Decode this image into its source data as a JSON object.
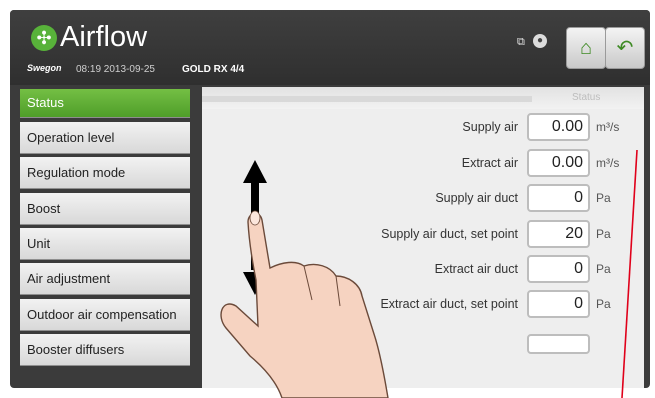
{
  "header": {
    "app_title": "Airflow",
    "brand": "Swegon",
    "timestamp": "08:19 2013-09-25",
    "unit_id": "GOLD RX",
    "page": "4/4",
    "network_icon": "network-icon",
    "user_icon": "user-icon",
    "home_icon": "home-icon",
    "back_icon": "back-arrow-icon",
    "logo_icon": "fan-icon"
  },
  "nav": {
    "items": [
      {
        "label": "Status",
        "active": true
      },
      {
        "label": "Operation level",
        "active": false
      },
      {
        "label": "Regulation mode",
        "active": false
      },
      {
        "label": "Boost",
        "active": false
      },
      {
        "label": "Unit",
        "active": false
      },
      {
        "label": "Air adjustment",
        "active": false
      },
      {
        "label": "Outdoor air compensation",
        "active": false
      },
      {
        "label": "Booster diffusers",
        "active": false
      }
    ]
  },
  "content": {
    "caption": "Status",
    "rows": [
      {
        "label": "Supply air",
        "value": "0.00",
        "unit": "m³/s"
      },
      {
        "label": "Extract air",
        "value": "0.00",
        "unit": "m³/s"
      },
      {
        "label": "Supply air duct",
        "value": "0",
        "unit": "Pa"
      },
      {
        "label": "Supply air duct, set point",
        "value": "20",
        "unit": "Pa"
      },
      {
        "label": "Extract air duct",
        "value": "0",
        "unit": "Pa"
      },
      {
        "label": "Extract air duct, set point",
        "value": "0",
        "unit": "Pa"
      }
    ]
  },
  "colors": {
    "accent": "#5aaa33",
    "header_bg": "#3a3a3a",
    "annotation_line": "#e0001a"
  }
}
